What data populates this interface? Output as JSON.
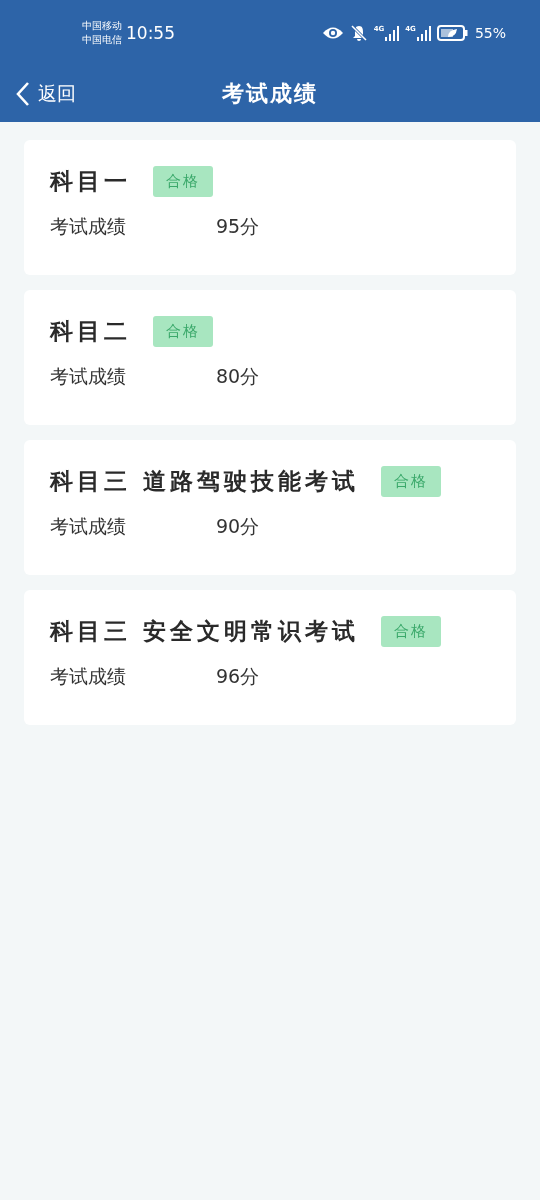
{
  "status_bar": {
    "carriers": [
      "中国移动",
      "中国电信"
    ],
    "time": "10:55",
    "network_labels": [
      "4G",
      "4G"
    ],
    "battery": "55%"
  },
  "nav": {
    "back": "返回",
    "title": "考试成绩"
  },
  "results": [
    {
      "subject": "科目一",
      "badge": "合格",
      "label": "考试成绩",
      "score": "95分"
    },
    {
      "subject": "科目二",
      "badge": "合格",
      "label": "考试成绩",
      "score": "80分"
    },
    {
      "subject": "科目三 道路驾驶技能考试",
      "badge": "合格",
      "label": "考试成绩",
      "score": "90分"
    },
    {
      "subject": "科目三 安全文明常识考试",
      "badge": "合格",
      "label": "考试成绩",
      "score": "96分"
    }
  ]
}
